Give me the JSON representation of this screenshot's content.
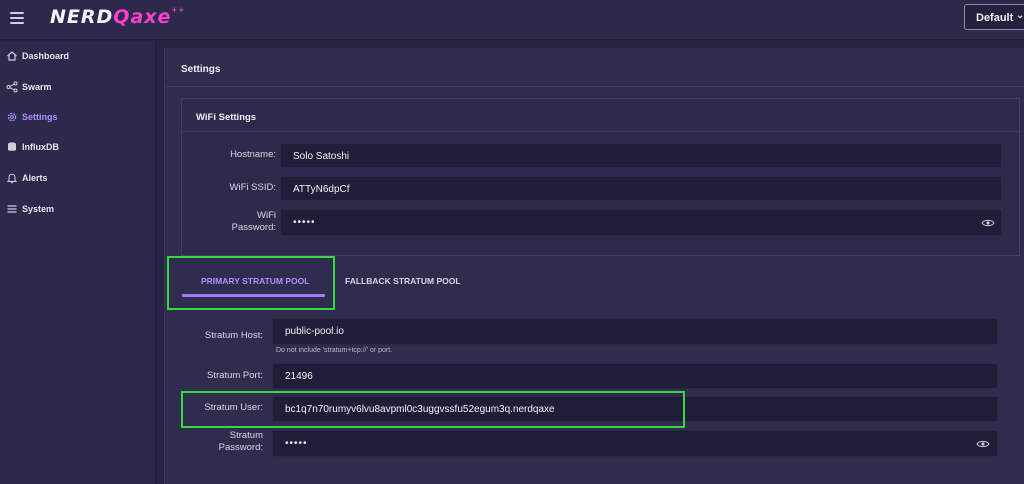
{
  "header": {
    "logo_main": "NERD",
    "logo_accent": "Qaxe",
    "logo_sup": "++",
    "theme_select": "Default"
  },
  "sidebar": {
    "items": [
      {
        "label": "Dashboard",
        "icon": "home-icon",
        "active": false
      },
      {
        "label": "Swarm",
        "icon": "share-icon",
        "active": false
      },
      {
        "label": "Settings",
        "icon": "gear-icon",
        "active": true
      },
      {
        "label": "InfluxDB",
        "icon": "database-icon",
        "active": false
      },
      {
        "label": "Alerts",
        "icon": "bell-icon",
        "active": false
      },
      {
        "label": "System",
        "icon": "menu-icon",
        "active": false
      }
    ]
  },
  "page": {
    "title": "Settings"
  },
  "wifi": {
    "title": "WiFi Settings",
    "hostname_label": "Hostname:",
    "hostname_value": "Solo Satoshi",
    "ssid_label": "WiFi SSID:",
    "ssid_value": "ATTyN6dpCf",
    "password_label_1": "WiFi",
    "password_label_2": "Password:",
    "password_value": "•••••"
  },
  "tabs": {
    "primary": "PRIMARY STRATUM POOL",
    "fallback": "FALLBACK STRATUM POOL"
  },
  "stratum": {
    "host_label": "Stratum Host:",
    "host_value": "public-pool.io",
    "host_hint": "Do not include 'stratum+tcp://' or port.",
    "port_label": "Stratum Port:",
    "port_value": "21496",
    "user_label": "Stratum User:",
    "user_value": "bc1q7n70rumyv6lvu8avpml0c3uggvssfu52egum3q.nerdqaxe",
    "password_label_1": "Stratum",
    "password_label_2": "Password:",
    "password_value": "•••••"
  },
  "colors": {
    "accent": "#a876ff",
    "highlight": "#39d640",
    "logo_accent": "#ff3fd0"
  }
}
